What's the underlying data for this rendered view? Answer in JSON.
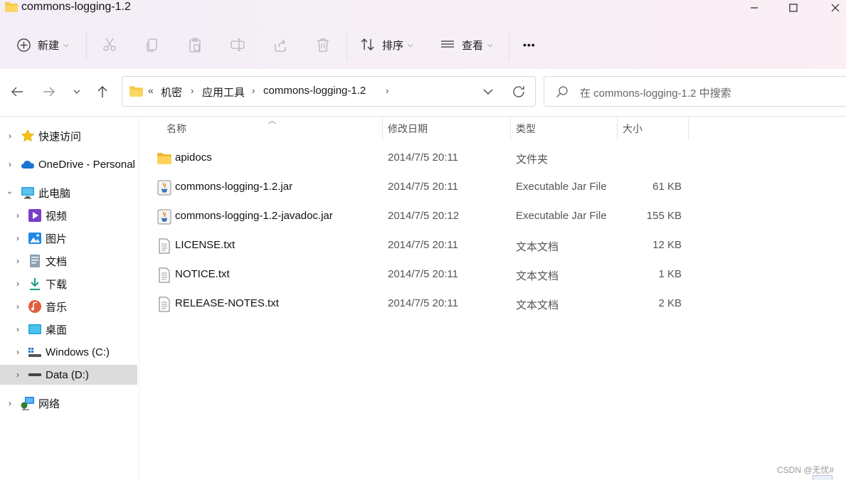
{
  "window": {
    "title": "commons-logging-1.2"
  },
  "toolbar": {
    "new_label": "新建",
    "sort_label": "排序",
    "view_label": "查看",
    "more_label": "•••"
  },
  "address": {
    "overflow": "«",
    "crumbs": [
      "机密",
      "应用工具",
      "commons-logging-1.2"
    ],
    "search_placeholder": "在 commons-logging-1.2 中搜索"
  },
  "sidebar": {
    "items": [
      {
        "label": "快速访问",
        "icon": "star-icon"
      },
      {
        "label": "OneDrive - Personal",
        "icon": "cloud-icon"
      },
      {
        "label": "此电脑",
        "icon": "computer-icon"
      },
      {
        "label": "视频",
        "icon": "video-icon"
      },
      {
        "label": "图片",
        "icon": "pictures-icon"
      },
      {
        "label": "文档",
        "icon": "documents-icon"
      },
      {
        "label": "下载",
        "icon": "download-icon"
      },
      {
        "label": "音乐",
        "icon": "music-icon"
      },
      {
        "label": "桌面",
        "icon": "desktop-icon"
      },
      {
        "label": "Windows (C:)",
        "icon": "drive-c-icon"
      },
      {
        "label": "Data (D:)",
        "icon": "drive-d-icon"
      },
      {
        "label": "网络",
        "icon": "network-icon"
      }
    ]
  },
  "columns": {
    "name": "名称",
    "date": "修改日期",
    "type": "类型",
    "size": "大小"
  },
  "files": [
    {
      "name": "apidocs",
      "date": "2014/7/5 20:11",
      "type": "文件夹",
      "size": "",
      "icon": "folder-icon"
    },
    {
      "name": "commons-logging-1.2.jar",
      "date": "2014/7/5 20:11",
      "type": "Executable Jar File",
      "size": "61 KB",
      "icon": "jar-icon"
    },
    {
      "name": "commons-logging-1.2-javadoc.jar",
      "date": "2014/7/5 20:12",
      "type": "Executable Jar File",
      "size": "155 KB",
      "icon": "jar-icon"
    },
    {
      "name": "LICENSE.txt",
      "date": "2014/7/5 20:11",
      "type": "文本文档",
      "size": "12 KB",
      "icon": "text-file-icon"
    },
    {
      "name": "NOTICE.txt",
      "date": "2014/7/5 20:11",
      "type": "文本文档",
      "size": "1 KB",
      "icon": "text-file-icon"
    },
    {
      "name": "RELEASE-NOTES.txt",
      "date": "2014/7/5 20:11",
      "type": "文本文档",
      "size": "2 KB",
      "icon": "text-file-icon"
    }
  ],
  "watermark": "CSDN @无忧#",
  "colors": {
    "folder": "#f8c94b",
    "selected": "#dcdcdc",
    "accent": "#0067c0"
  }
}
